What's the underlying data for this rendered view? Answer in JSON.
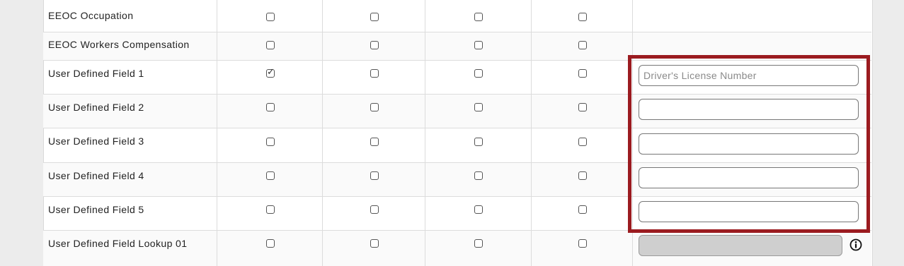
{
  "rows": [
    {
      "label": "EEOC Occupation",
      "checks": [
        false,
        false,
        false,
        false
      ],
      "field": null
    },
    {
      "label": "EEOC Workers Compensation",
      "checks": [
        false,
        false,
        false,
        false
      ],
      "field": null
    },
    {
      "label": "User Defined Field 1",
      "checks": [
        true,
        false,
        false,
        false
      ],
      "field": {
        "type": "text",
        "value": "",
        "placeholder": "Driver's License Number"
      }
    },
    {
      "label": "User Defined Field 2",
      "checks": [
        false,
        false,
        false,
        false
      ],
      "field": {
        "type": "text",
        "value": "",
        "placeholder": ""
      }
    },
    {
      "label": "User Defined Field 3",
      "checks": [
        false,
        false,
        false,
        false
      ],
      "field": {
        "type": "text",
        "value": "",
        "placeholder": ""
      }
    },
    {
      "label": "User Defined Field 4",
      "checks": [
        false,
        false,
        false,
        false
      ],
      "field": {
        "type": "text",
        "value": "",
        "placeholder": ""
      }
    },
    {
      "label": "User Defined Field 5",
      "checks": [
        false,
        false,
        false,
        false
      ],
      "field": {
        "type": "text",
        "value": "",
        "placeholder": ""
      }
    },
    {
      "label": "User Defined Field Lookup 01",
      "checks": [
        false,
        false,
        false,
        false
      ],
      "field": {
        "type": "lookup",
        "value": "",
        "placeholder": ""
      }
    }
  ],
  "icons": {
    "info": "info-icon"
  },
  "colors": {
    "highlight": "#9b1b20"
  }
}
